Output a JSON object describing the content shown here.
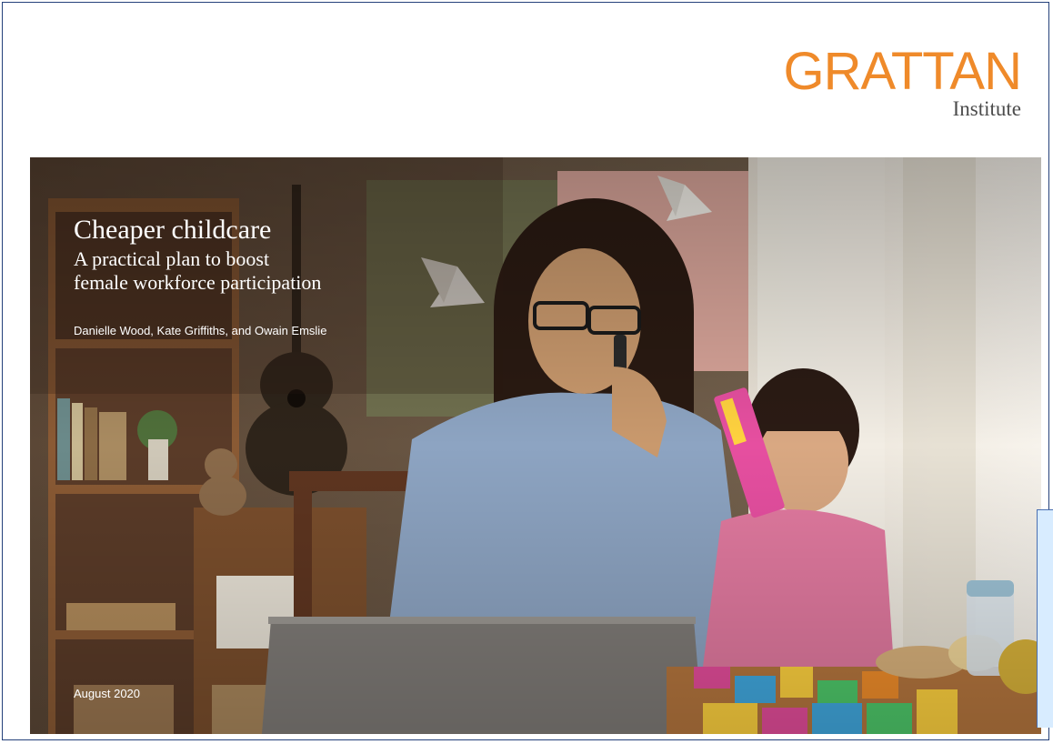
{
  "logo": {
    "name": "GRATTAN",
    "sub": "Institute"
  },
  "report": {
    "title": "Cheaper childcare",
    "subtitle": "A practical plan to boost\nfemale workforce participation",
    "authors": "Danielle Wood, Kate Griffiths, and Owain Emslie",
    "date": "August 2020"
  },
  "colors": {
    "brand_orange": "#ef8a2a",
    "frame_border": "#24407a"
  }
}
